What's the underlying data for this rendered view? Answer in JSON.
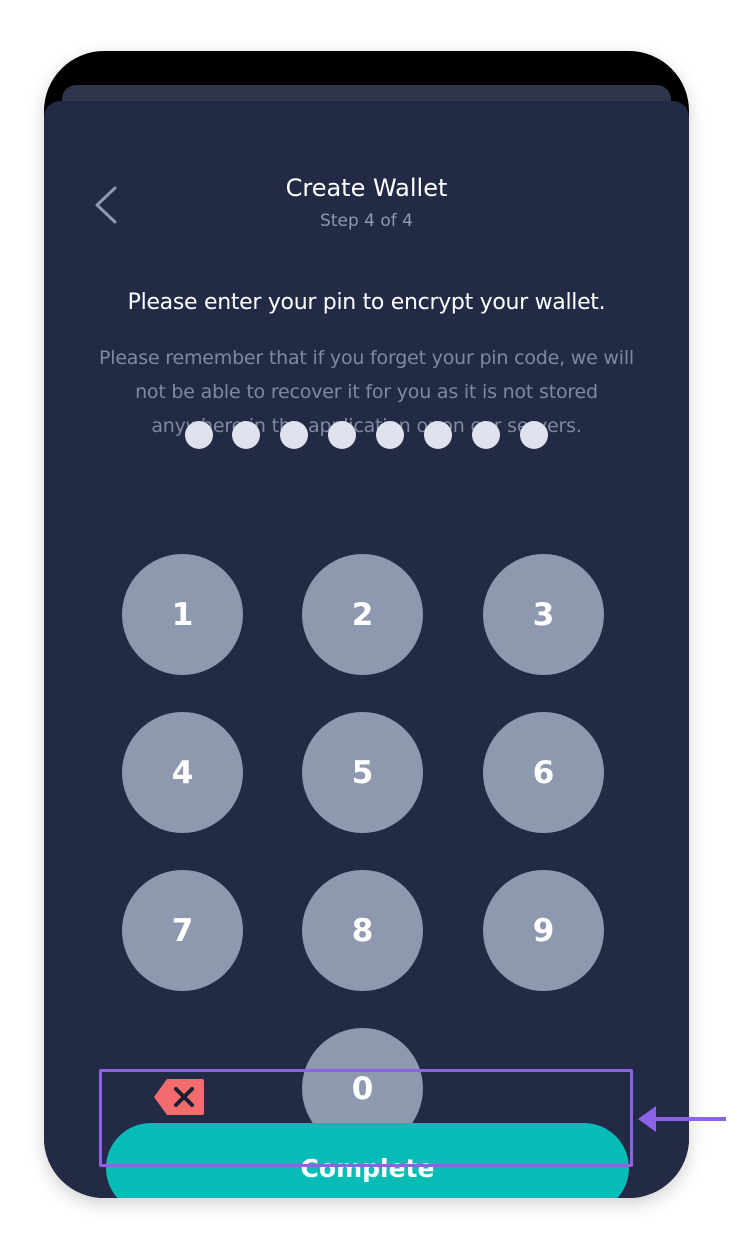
{
  "header": {
    "title": "Create Wallet",
    "subtitle": "Step 4 of 4",
    "back_icon": "chevron-left-icon"
  },
  "content": {
    "heading": "Please enter your pin to encrypt your wallet.",
    "warning": "Please remember that if you forget your pin code, we will not be able to recover it for you as it is not stored anywhere in the application or on our servers."
  },
  "pin": {
    "length": 8,
    "filled": 0
  },
  "keypad": {
    "keys": [
      "1",
      "2",
      "3",
      "4",
      "5",
      "6",
      "7",
      "8",
      "9",
      "0"
    ],
    "delete_icon": "backspace-icon"
  },
  "actions": {
    "complete_label": "Complete"
  },
  "annotation": {
    "arrow_icon": "arrow-left-icon"
  },
  "colors": {
    "background": "#222a46",
    "key": "#8e99b0",
    "accent": "#05bdb6",
    "delete": "#f26c6e",
    "highlight": "#8a63e6"
  }
}
